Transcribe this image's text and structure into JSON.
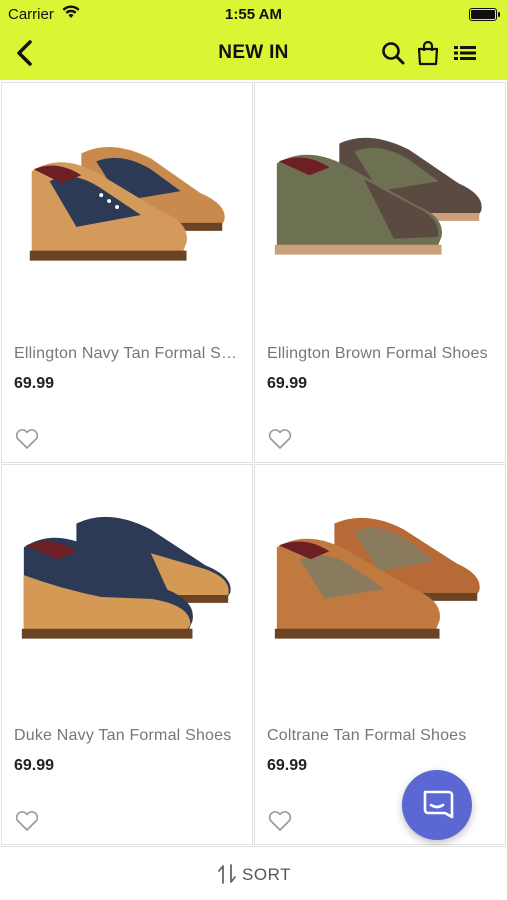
{
  "status_bar": {
    "carrier": "Carrier",
    "time": "1:55 AM"
  },
  "header": {
    "title": "NEW IN",
    "icons": [
      "back-chevron-icon",
      "search-icon",
      "shopping-bag-icon",
      "list-view-icon"
    ],
    "background": "#d9f533"
  },
  "products": [
    {
      "name": "Ellington Navy Tan Formal Shoes",
      "price": "69.99",
      "colors": [
        "#2c3a55",
        "#c98a4e"
      ]
    },
    {
      "name": "Ellington Brown Formal Shoes",
      "price": "69.99",
      "colors": [
        "#6e7052",
        "#5a4a42"
      ]
    },
    {
      "name": "Duke Navy Tan Formal Shoes",
      "price": "69.99",
      "colors": [
        "#2c3a55",
        "#d49a55"
      ]
    },
    {
      "name": "Coltrane Tan Formal Shoes",
      "price": "69.99",
      "colors": [
        "#8a7a5e",
        "#b76a35"
      ]
    }
  ],
  "bottom_bar": {
    "sort_label": "SORT"
  },
  "chat": {
    "icon": "chat-bubble-icon",
    "color": "#5b67d3"
  }
}
